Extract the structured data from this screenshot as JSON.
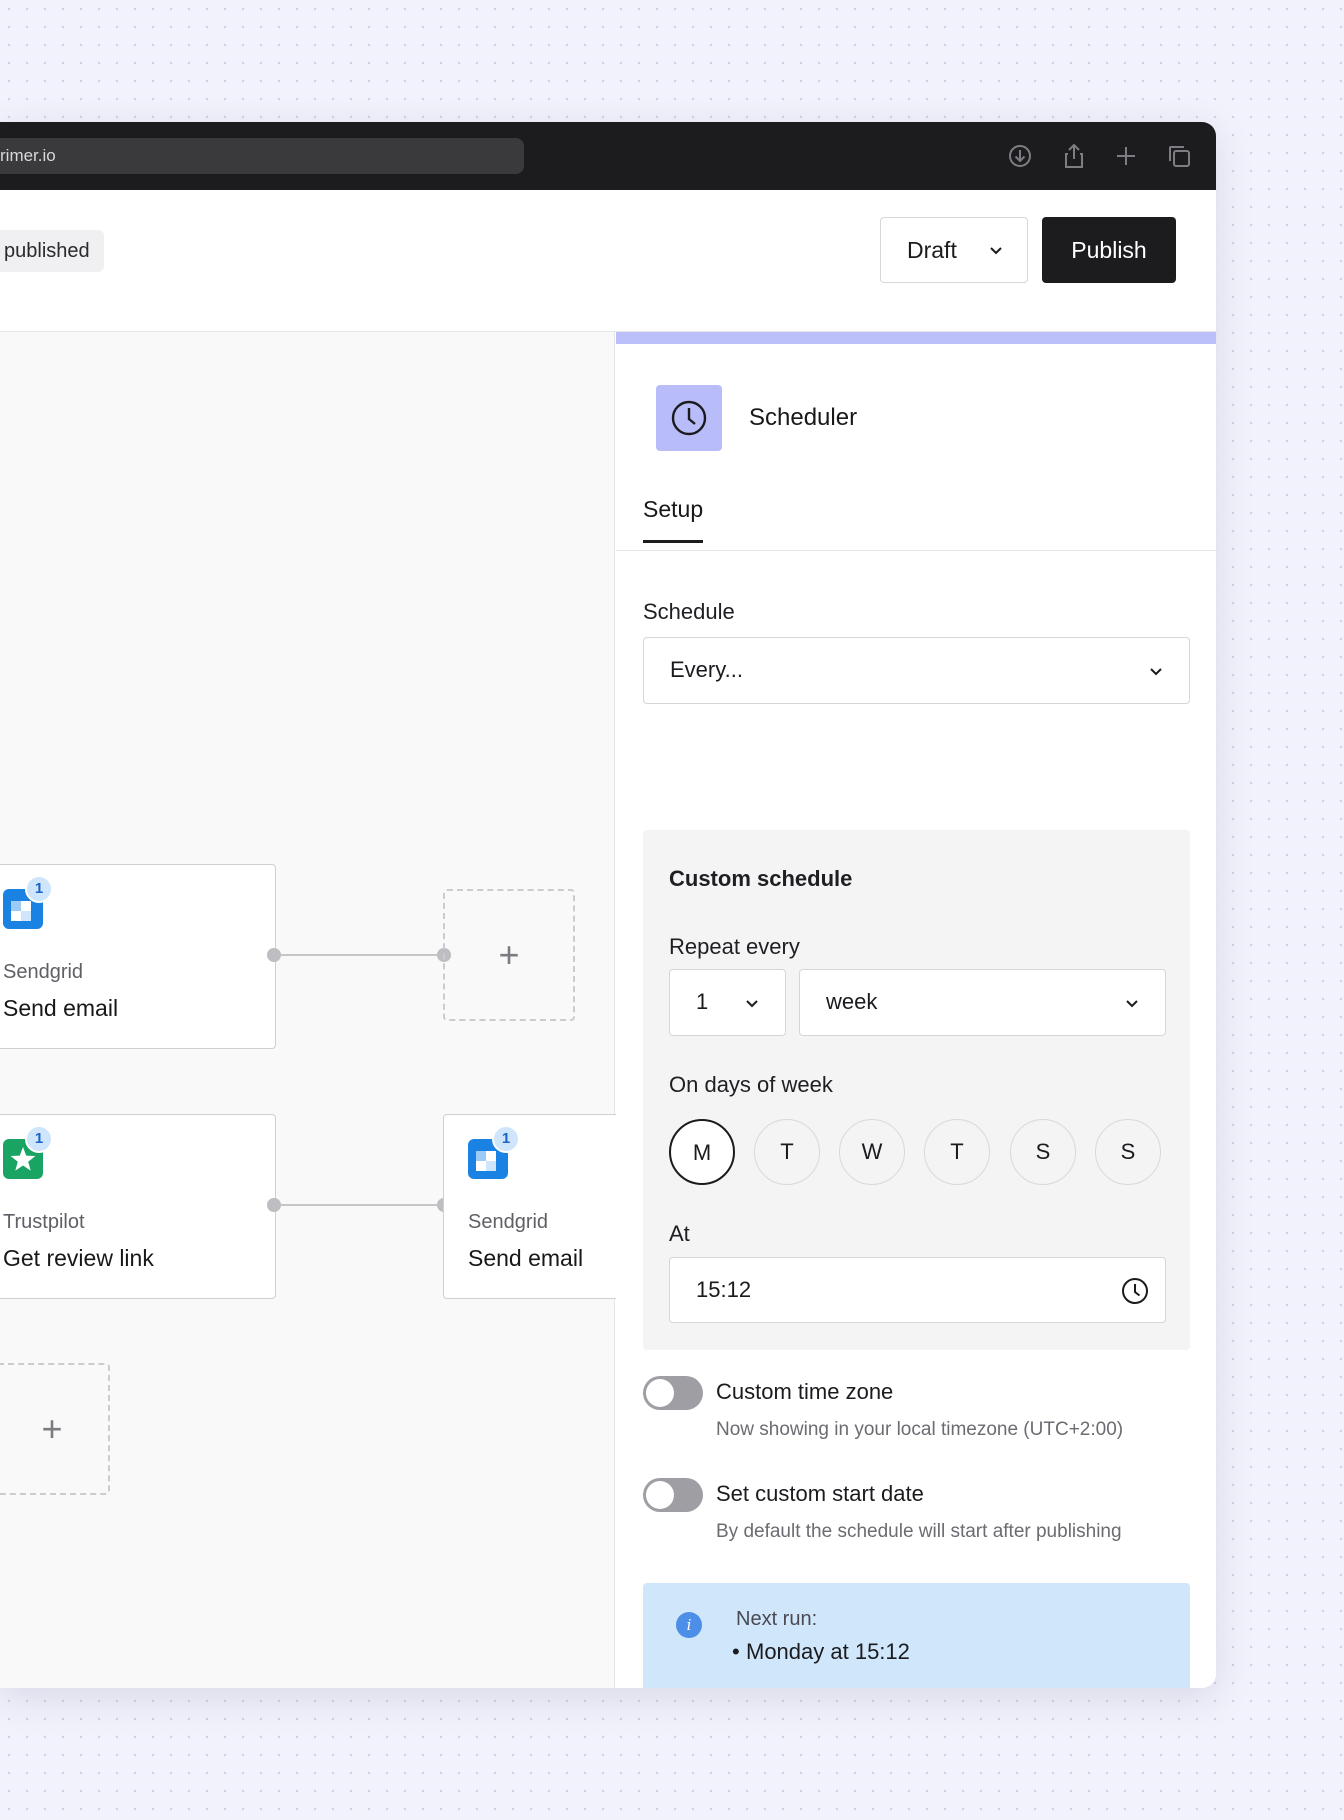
{
  "browser": {
    "url": "rimer.io",
    "icons": [
      "download-icon",
      "share-icon",
      "plus-icon",
      "tabs-icon"
    ]
  },
  "toolbar": {
    "status": "published",
    "version_select": "Draft",
    "publish_label": "Publish"
  },
  "canvas": {
    "nodes": [
      {
        "app": "Sendgrid",
        "action": "Send email",
        "badge": "1",
        "icon": "sendgrid-icon"
      },
      {
        "app": "Trustpilot",
        "action": "Get review link",
        "badge": "1",
        "icon": "trustpilot-icon"
      },
      {
        "app": "Sendgrid",
        "action": "Send email",
        "badge": "1",
        "icon": "sendgrid-icon"
      }
    ],
    "add_symbol": "+"
  },
  "panel": {
    "title": "Scheduler",
    "icon": "clock-icon",
    "tabs": [
      "Setup"
    ],
    "schedule_label": "Schedule",
    "schedule_value": "Every...",
    "custom": {
      "title": "Custom schedule",
      "repeat_label": "Repeat every",
      "repeat_count": "1",
      "repeat_unit": "week",
      "days_label": "On days of week",
      "days": [
        "M",
        "T",
        "W",
        "T",
        "S",
        "S"
      ],
      "selected_day_index": 0,
      "at_label": "At",
      "time": "15:12"
    },
    "timezone": {
      "label": "Custom time zone",
      "help": "Now showing in your local timezone (UTC+2:00)",
      "enabled": false
    },
    "start_date": {
      "label": "Set custom start date",
      "help": "By default the schedule will start after publishing",
      "enabled": false
    },
    "next_run": {
      "title": "Next run:",
      "items": [
        "Monday at 15:12"
      ]
    }
  },
  "colors": {
    "accent": "#bbbffa",
    "info_bg": "#cfe6fb",
    "primary_button": "#1c1c1e"
  }
}
